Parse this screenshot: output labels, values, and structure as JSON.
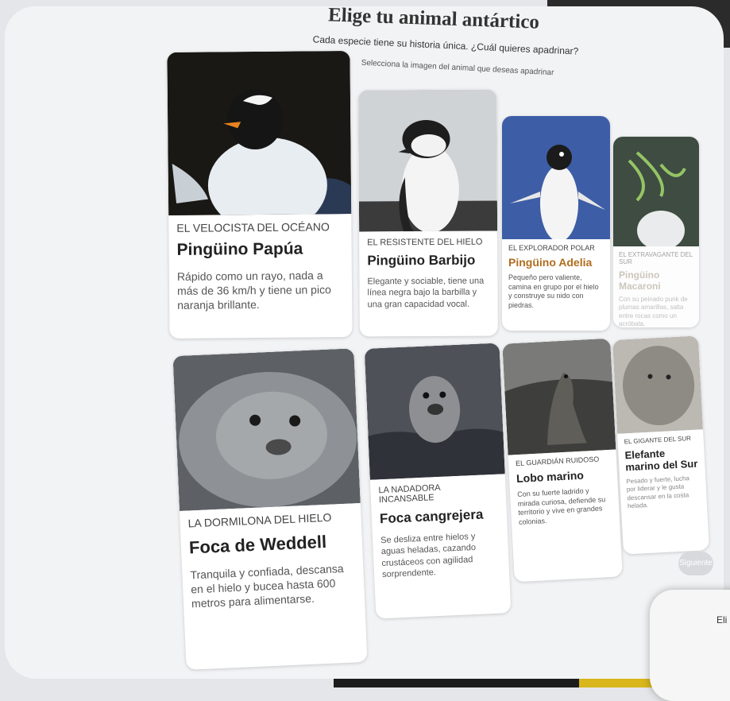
{
  "header": {
    "title": "Elige tu animal antártico",
    "subtitle": "Cada especie tiene su historia única. ¿Cuál quieres apadrinar?",
    "instruction": "Selecciona la imagen del animal que deseas apadrinar"
  },
  "cards": [
    {
      "tag": "EL VELOCISTA DEL OCÉANO",
      "name": "Pingüino Papúa",
      "desc": "Rápido como un rayo, nada a más de 36 km/h y tiene un pico naranja brillante.",
      "photo": "gentoo-penguin"
    },
    {
      "tag": "EL RESISTENTE DEL HIELO",
      "name": "Pingüino Barbijo",
      "desc": "Elegante y sociable, tiene una línea negra bajo la barbilla y una gran capacidad vocal.",
      "photo": "chinstrap-penguin"
    },
    {
      "tag": "EL EXPLORADOR POLAR",
      "name": "Pingüino Adelia",
      "desc": "Pequeño pero valiente, camina en grupo por el hielo y construye su nido con piedras.",
      "photo": "adelie-penguin"
    },
    {
      "tag": "EL EXTRAVAGANTE DEL SUR",
      "name": "Pingüino Macaroni",
      "desc": "Con su peinado punk de plumas amarillas, salta entre rocas como un acróbata.",
      "photo": "macaroni-penguin"
    },
    {
      "tag": "LA DORMILONA DEL HIELO",
      "name": "Foca de Weddell",
      "desc": "Tranquila y confiada, descansa en el hielo y bucea hasta 600 metros para alimentarse.",
      "photo": "weddell-seal"
    },
    {
      "tag": "LA NADADORA INCANSABLE",
      "name": "Foca cangrejera",
      "desc": "Se desliza entre hielos y aguas heladas, cazando crustáceos con agilidad sorprendente.",
      "photo": "crabeater-seal"
    },
    {
      "tag": "EL GUARDIÁN RUIDOSO",
      "name": "Lobo marino",
      "desc": "Con su fuerte ladrido y mirada curiosa, defiende su territorio y vive en grandes colonias.",
      "photo": "fur-seal"
    },
    {
      "tag": "EL GIGANTE DEL SUR",
      "name": "Elefante marino del Sur",
      "desc": "Pesado y fuerte, lucha por liderar y le gusta descansar en la costa helada.",
      "photo": "elephant-seal"
    }
  ],
  "next_button": "Siguiente",
  "corner_popup_text": "Eli"
}
